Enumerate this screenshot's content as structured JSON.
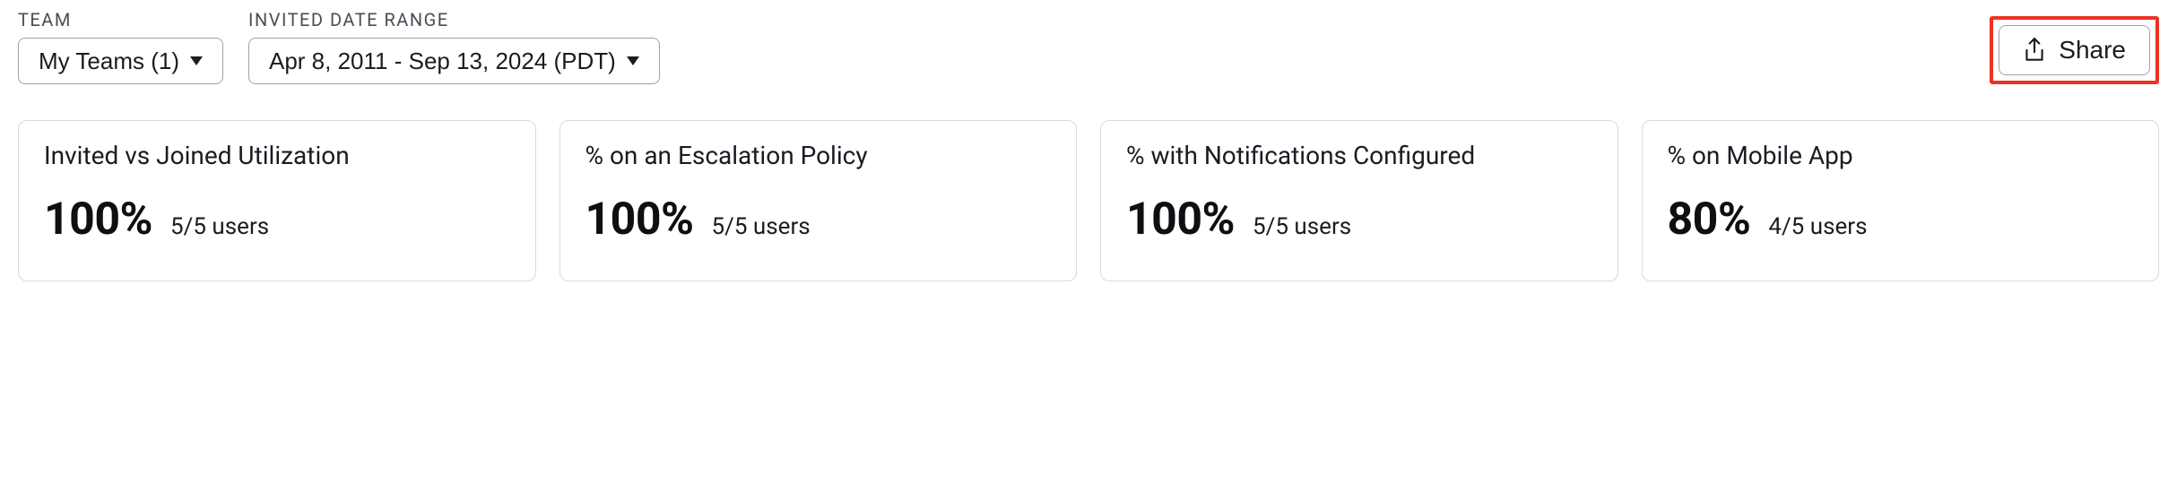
{
  "filters": {
    "team": {
      "label": "TEAM",
      "value": "My Teams (1)"
    },
    "dateRange": {
      "label": "INVITED DATE RANGE",
      "value": "Apr 8, 2011 - Sep 13, 2024 (PDT)"
    }
  },
  "share": {
    "label": "Share"
  },
  "cards": [
    {
      "title": "Invited vs Joined Utilization",
      "percent": "100%",
      "subtext": "5/5 users"
    },
    {
      "title": "% on an Escalation Policy",
      "percent": "100%",
      "subtext": "5/5 users"
    },
    {
      "title": "% with Notifications Configured",
      "percent": "100%",
      "subtext": "5/5 users"
    },
    {
      "title": "% on Mobile App",
      "percent": "80%",
      "subtext": "4/5 users"
    }
  ]
}
